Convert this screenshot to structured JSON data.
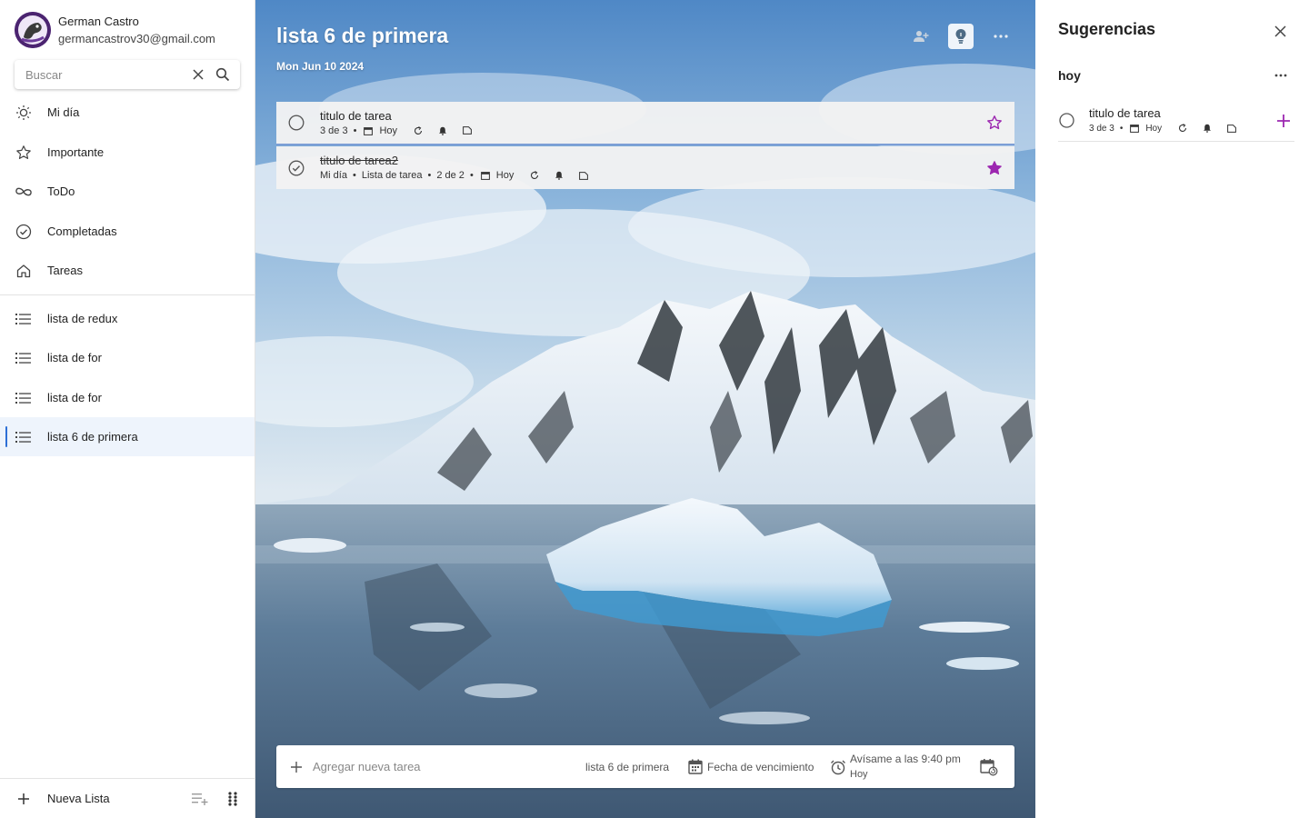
{
  "user": {
    "name": "German Castro",
    "email": "germancastrov30@gmail.com"
  },
  "search": {
    "placeholder": "Buscar"
  },
  "nav": [
    {
      "label": "Mi día",
      "icon": "sun-icon"
    },
    {
      "label": "Importante",
      "icon": "star-icon"
    },
    {
      "label": "ToDo",
      "icon": "infinity-icon"
    },
    {
      "label": "Completadas",
      "icon": "check-circle-icon"
    },
    {
      "label": "Tareas",
      "icon": "home-icon"
    }
  ],
  "lists": [
    {
      "label": "lista de redux"
    },
    {
      "label": "lista de for"
    },
    {
      "label": "lista de for"
    },
    {
      "label": "lista 6 de primera",
      "active": true
    }
  ],
  "footer": {
    "new_list": "Nueva Lista"
  },
  "main": {
    "title": "lista 6 de primera",
    "date": "Mon Jun 10 2024",
    "tasks": [
      {
        "title": "titulo de tarea",
        "steps": "3 de 3",
        "due": "Hoy",
        "completed": false,
        "important": true,
        "star_filled": false
      },
      {
        "title": "titulo de tarea2",
        "my_day": "Mi día",
        "list": "Lista de tarea",
        "steps": "2 de 2",
        "due": "Hoy",
        "completed": true,
        "important": true,
        "star_filled": true
      }
    ],
    "add_bar": {
      "placeholder": "Agregar nueva tarea",
      "list_name": "lista 6 de primera",
      "due_label": "Fecha de vencimiento",
      "reminder_label": "Avísame a las 9:40 pm",
      "reminder_sub": "Hoy"
    }
  },
  "suggestions": {
    "title": "Sugerencias",
    "section": "hoy",
    "items": [
      {
        "title": "titulo de tarea",
        "steps": "3 de 3",
        "due": "Hoy"
      }
    ]
  },
  "colors": {
    "accent": "#9c27b0",
    "active_nav": "#eef4fc",
    "active_bar": "#2d6fd6"
  }
}
